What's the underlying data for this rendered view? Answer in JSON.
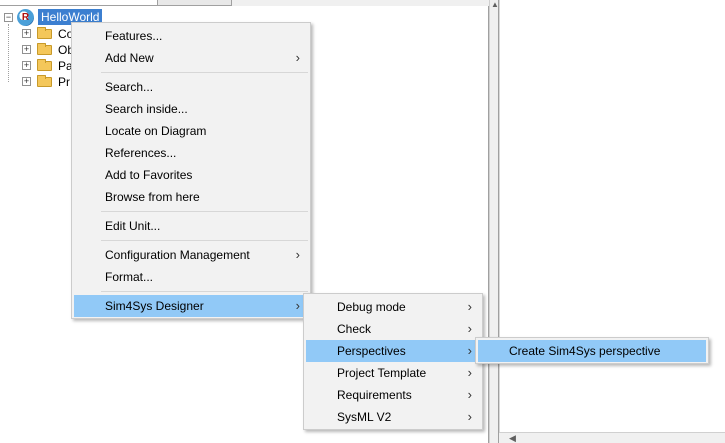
{
  "tree": {
    "root_label": "HelloWorld",
    "root_icon": "model-icon",
    "items": [
      {
        "label": "Co",
        "icon": "folder-icon"
      },
      {
        "label": "Ob",
        "icon": "folder-icon"
      },
      {
        "label": "Pa",
        "icon": "folder-icon"
      },
      {
        "label": "Pr",
        "icon": "folder-icon"
      }
    ]
  },
  "context_menu": {
    "items": [
      {
        "label": "Features...",
        "submenu": false
      },
      {
        "label": "Add New",
        "submenu": true
      },
      {
        "label": "Search...",
        "submenu": false
      },
      {
        "label": "Search inside...",
        "submenu": false
      },
      {
        "label": "Locate on Diagram",
        "submenu": false
      },
      {
        "label": "References...",
        "submenu": false
      },
      {
        "label": "Add to Favorites",
        "submenu": false
      },
      {
        "label": "Browse from here",
        "submenu": false
      },
      {
        "label": "Edit Unit...",
        "submenu": false
      },
      {
        "label": "Configuration Management",
        "submenu": true
      },
      {
        "label": "Format...",
        "submenu": false
      },
      {
        "label": "Sim4Sys Designer",
        "submenu": true,
        "highlighted": true
      }
    ]
  },
  "sim4sys_menu": {
    "items": [
      {
        "label": "Debug mode",
        "submenu": true
      },
      {
        "label": "Check",
        "submenu": true
      },
      {
        "label": "Perspectives",
        "submenu": true,
        "highlighted": true
      },
      {
        "label": "Project Template",
        "submenu": true
      },
      {
        "label": "Requirements",
        "submenu": true
      },
      {
        "label": "SysML V2",
        "submenu": true
      }
    ]
  },
  "perspectives_menu": {
    "items": [
      {
        "label": "Create Sim4Sys perspective",
        "highlighted": true
      }
    ]
  },
  "colors": {
    "selection": "#3c7fd0",
    "menu_highlight": "#91c9f7",
    "menu_background": "#f2f2f2"
  }
}
